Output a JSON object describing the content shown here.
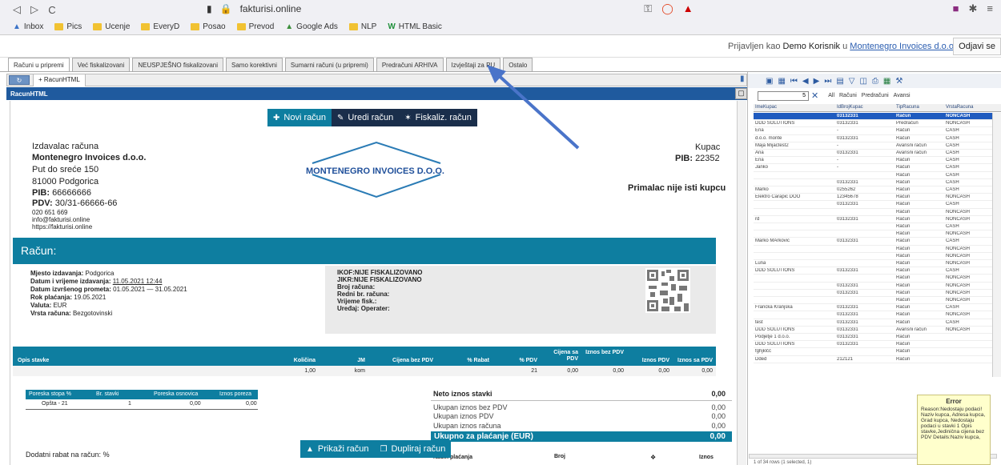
{
  "browser": {
    "back": "◁",
    "forward": "▷",
    "reload": "C",
    "url": "fakturisi.online"
  },
  "bookmarks": [
    "Inbox",
    "Pics",
    "Ucenje",
    "EveryD",
    "Posao",
    "Prevod",
    "Google Ads",
    "NLP",
    "HTML Basic"
  ],
  "login": {
    "prefix": "Prijavljen kao",
    "user": "Demo Korisnik",
    "mid": "u",
    "company": "Montenegro Invoices d.o.o.",
    "logout": "Odjavi se"
  },
  "tabs": [
    "Računi u pripremi",
    "Već fiskalizovani",
    "NEUSPJEŠNO fiskalizovani",
    "Samo korektivni",
    "Sumarni računi (u pripremi)",
    "Predračuni ARHIVA",
    "Izvještaji za PU",
    "Ostalo"
  ],
  "subtab": "+ RacunHTML",
  "panel_title": "RacunHTML",
  "actions": {
    "new": "Novi račun",
    "edit": "Uredi račun",
    "fiscalize": "Fiskaliz. račun",
    "show": "Prikaži račun",
    "duplicate": "Dupliraj račun"
  },
  "issuer": {
    "heading": "Izdavalac računa",
    "name": "Montenegro Invoices d.o.o.",
    "street": "Put do sreće 150",
    "city": "81000 Podgorica",
    "pib_label": "PIB:",
    "pib": "66666666",
    "pdv_label": "PDV:",
    "pdv": "30/31-66666-66",
    "phone": "020 651 669",
    "email": "info@fakturisi.online",
    "web": "https://fakturisi.online"
  },
  "logo_text": "MONTENEGRO INVOICES D.O.O.",
  "buyer": {
    "heading": "Kupac",
    "pib_label": "PIB:",
    "pib": "22352",
    "recipient": "Primalac nije isti kupcu"
  },
  "invoice_title": "Račun:",
  "details": {
    "place_label": "Mjesto izdavanja:",
    "place": "Podgorica",
    "date_label": "Datum i vrijeme izdavanja:",
    "date": "11.05.2021 12:44",
    "period_label": "Datum izvršenog prometa:",
    "period": "01.05.2021 — 31.05.2021",
    "due_label": "Rok plaćanja:",
    "due": "19.05.2021",
    "currency_label": "Valuta:",
    "currency": "EUR",
    "type_label": "Vrsta računa:",
    "type": "Bezgotovinski"
  },
  "fiscal": {
    "ikof": "IKOF:NIJE FISKALIZOVANO",
    "jikr": "JIKR:NIJE FISKALIZOVANO",
    "broj": "Broj računa:",
    "redni": "Redni br. računa:",
    "vrijeme": "Vrijeme fisk.:",
    "uredjaj": "Uređaj:",
    "operater": "Operater:"
  },
  "items": {
    "headers": [
      "Opis stavke",
      "Količina",
      "JM",
      "Cijena bez PDV",
      "% Rabat",
      "% PDV",
      "Cijena sa PDV",
      "Iznos bez PDV",
      "Iznos PDV",
      "Iznos sa PDV"
    ],
    "row": [
      "",
      "1,00",
      "kom",
      "",
      "",
      "21",
      "0,00",
      "0,00",
      "0,00",
      "0,00"
    ]
  },
  "tax": {
    "headers": [
      "Poreska stopa %",
      "Br. stavki",
      "Poreska osnovica",
      "Iznos poreza"
    ],
    "row": [
      "Opšta - 21",
      "1",
      "0,00",
      "0,00"
    ]
  },
  "sums": [
    {
      "label": "Neto iznos stavki",
      "value": "0,00"
    },
    {
      "label": "Ukupan iznos bez PDV",
      "value": "0,00"
    },
    {
      "label": "Ukupan iznos PDV",
      "value": "0,00"
    },
    {
      "label": "Ukupan iznos računa",
      "value": "0,00"
    }
  ],
  "total": {
    "label": "Ukupno za plaćanje (EUR)",
    "value": "0,00"
  },
  "discount_label": "Dodatni rabat na račun:",
  "discount_value": "%",
  "payment": {
    "label": "Način plaćanja",
    "broj": "Broj",
    "iznos": "Iznos"
  },
  "grid": {
    "page_value": "5",
    "filters": [
      "All",
      "Računi",
      "Predračuni",
      "Avansi"
    ],
    "headers": [
      "ImeKupac",
      "IdBrojKupac",
      "TipRacuna",
      "VrstaRacuna"
    ],
    "rows": [
      [
        "",
        "03132331",
        "Račun",
        "NONCASH"
      ],
      [
        "DDD SOLUTIONS",
        "03132331",
        "Predračun",
        "NONCASH"
      ],
      [
        "Ena",
        "-",
        "Račun",
        "CASH"
      ],
      [
        "d.o.o. monte",
        "03132331",
        "Račun",
        "CASH"
      ],
      [
        "Maja Mijactest2",
        "-",
        "Avansni račun",
        "CASH"
      ],
      [
        "Ana",
        "03132331",
        "Avansni račun",
        "CASH"
      ],
      [
        "Ena",
        "-",
        "Račun",
        "CASH"
      ],
      [
        "Janko",
        "-",
        "Račun",
        "CASH"
      ],
      [
        "",
        "",
        "Račun",
        "CASH"
      ],
      [
        "",
        "03132331",
        "Račun",
        "CASH"
      ],
      [
        "Marko",
        "0255262",
        "Račun",
        "CASH"
      ],
      [
        "Elektro Carapic DOO",
        "12345678",
        "Račun",
        "NONCASH"
      ],
      [
        "",
        "03132331",
        "Račun",
        "CASH"
      ],
      [
        "",
        "",
        "Račun",
        "NONCASH"
      ],
      [
        "rd",
        "03132331",
        "Račun",
        "NONCASH"
      ],
      [
        "",
        "",
        "Račun",
        "CASH"
      ],
      [
        "",
        "",
        "Račun",
        "NONCASH"
      ],
      [
        "Marko MArkovic",
        "03132331",
        "Račun",
        "CASH"
      ],
      [
        "",
        "",
        "Račun",
        "NONCASH"
      ],
      [
        "",
        "",
        "Račun",
        "NONCASH"
      ],
      [
        "Luna",
        "",
        "Račun",
        "NONCASH"
      ],
      [
        "DDD SOLUTIONS",
        "03132331",
        "Račun",
        "CASH"
      ],
      [
        "",
        "",
        "Račun",
        "NONCASH"
      ],
      [
        "",
        "03132331",
        "Račun",
        "NONCASH"
      ],
      [
        "",
        "03132331",
        "Račun",
        "NONCASH"
      ],
      [
        "",
        "",
        "Račun",
        "NONCASH"
      ],
      [
        "Francka Kranjska",
        "03132331",
        "Račun",
        "CASH"
      ],
      [
        "",
        "03132331",
        "Račun",
        "NONCASH"
      ],
      [
        "test",
        "03132331",
        "Račun",
        "CASH"
      ],
      [
        "DDD SOLUTIONS",
        "03132331",
        "Avansni račun",
        "NONCASH"
      ],
      [
        "Podjetje 1 d.o.o.",
        "03132331",
        "Račun",
        ""
      ],
      [
        "DDD SOLUTIONS",
        "03132331",
        "Račun",
        ""
      ],
      [
        "fghjklčć",
        "",
        "Račun",
        ""
      ],
      [
        "Dded",
        "212121",
        "Račun",
        ""
      ]
    ],
    "footer": "1 of 34 rows (1 selected, 1)"
  },
  "error": {
    "title": "Error",
    "body": "Reason:Nedostaju podaci! Naziv kupca, Adresa kupca, Grad kupca, Nedostaju podaci u stavki 1 Opis stavke,Jedinična cijena bez PDV Details:Naziv kupca,"
  },
  "colors": {
    "accent": "#0e7ea0",
    "dark": "#1a2e4b",
    "header": "#1f5a9e",
    "selected": "#1f5bbf"
  }
}
